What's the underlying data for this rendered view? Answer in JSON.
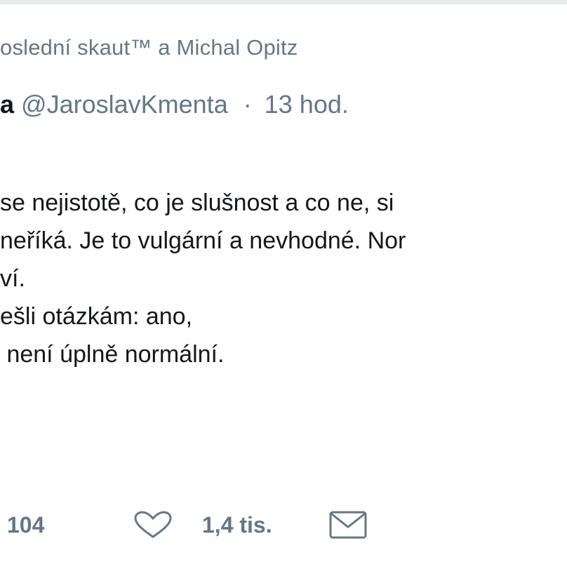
{
  "social_context": {
    "text": "oslední skaut™ a Michal Opitz"
  },
  "tweet": {
    "author_name_fragment": "a",
    "handle": "@JaroslavKmenta",
    "separator": "·",
    "time": "13 hod.",
    "lines": [
      "se nejistotě, co je slušnost a co ne, si",
      "neříká. Je to vulgární a nevhodné. Nor",
      "ví.",
      "ešli otázkám: ano,",
      " není úplně normální."
    ]
  },
  "actions": {
    "retweet_count": "104",
    "like_count": "1,4 tis.",
    "icons": {
      "like": "heart-icon",
      "message": "envelope-icon"
    }
  },
  "colors": {
    "text": "#14171a",
    "secondary": "#657786",
    "border": "#e6ecf0"
  }
}
